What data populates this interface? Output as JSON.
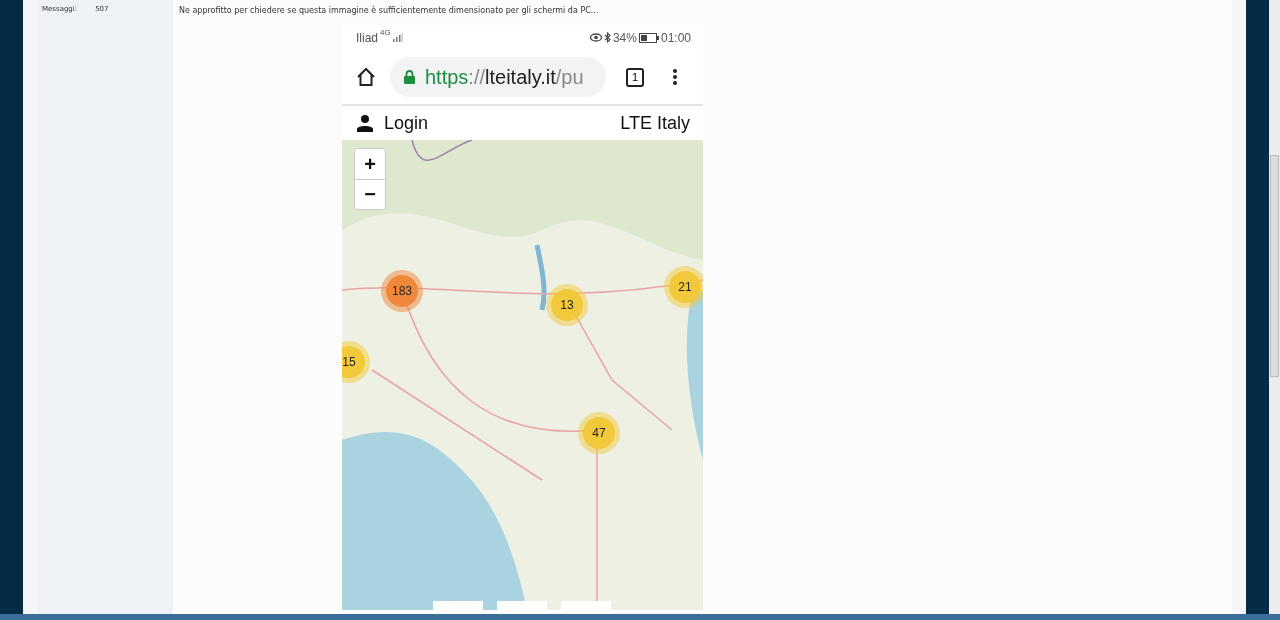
{
  "sidebar": {
    "label": "Messaggi:",
    "value": "507"
  },
  "post": {
    "text": "Ne approfitto per chiedere se questa immagine è sufficientemente dimensionato per gli schermi da PC...",
    "screenshot": {
      "status": {
        "carrier": "Iliad",
        "network": "4G",
        "battery": "34%",
        "time": "01:00"
      },
      "address": {
        "scheme": "https",
        "separator": "://",
        "host": "lteitaly.it",
        "path": "/pu"
      },
      "tab_count": "1",
      "header": {
        "login": "Login",
        "title": "LTE Italy"
      },
      "zoom": {
        "plus": "+",
        "minus": "−"
      },
      "clusters": [
        {
          "count": "183",
          "color": "#f0883c"
        },
        {
          "count": "13",
          "color": "#f1c93a"
        },
        {
          "count": "21",
          "color": "#f1c93a"
        },
        {
          "count": "15",
          "color": "#f1c93a"
        },
        {
          "count": "47",
          "color": "#f1c93a"
        }
      ]
    }
  }
}
